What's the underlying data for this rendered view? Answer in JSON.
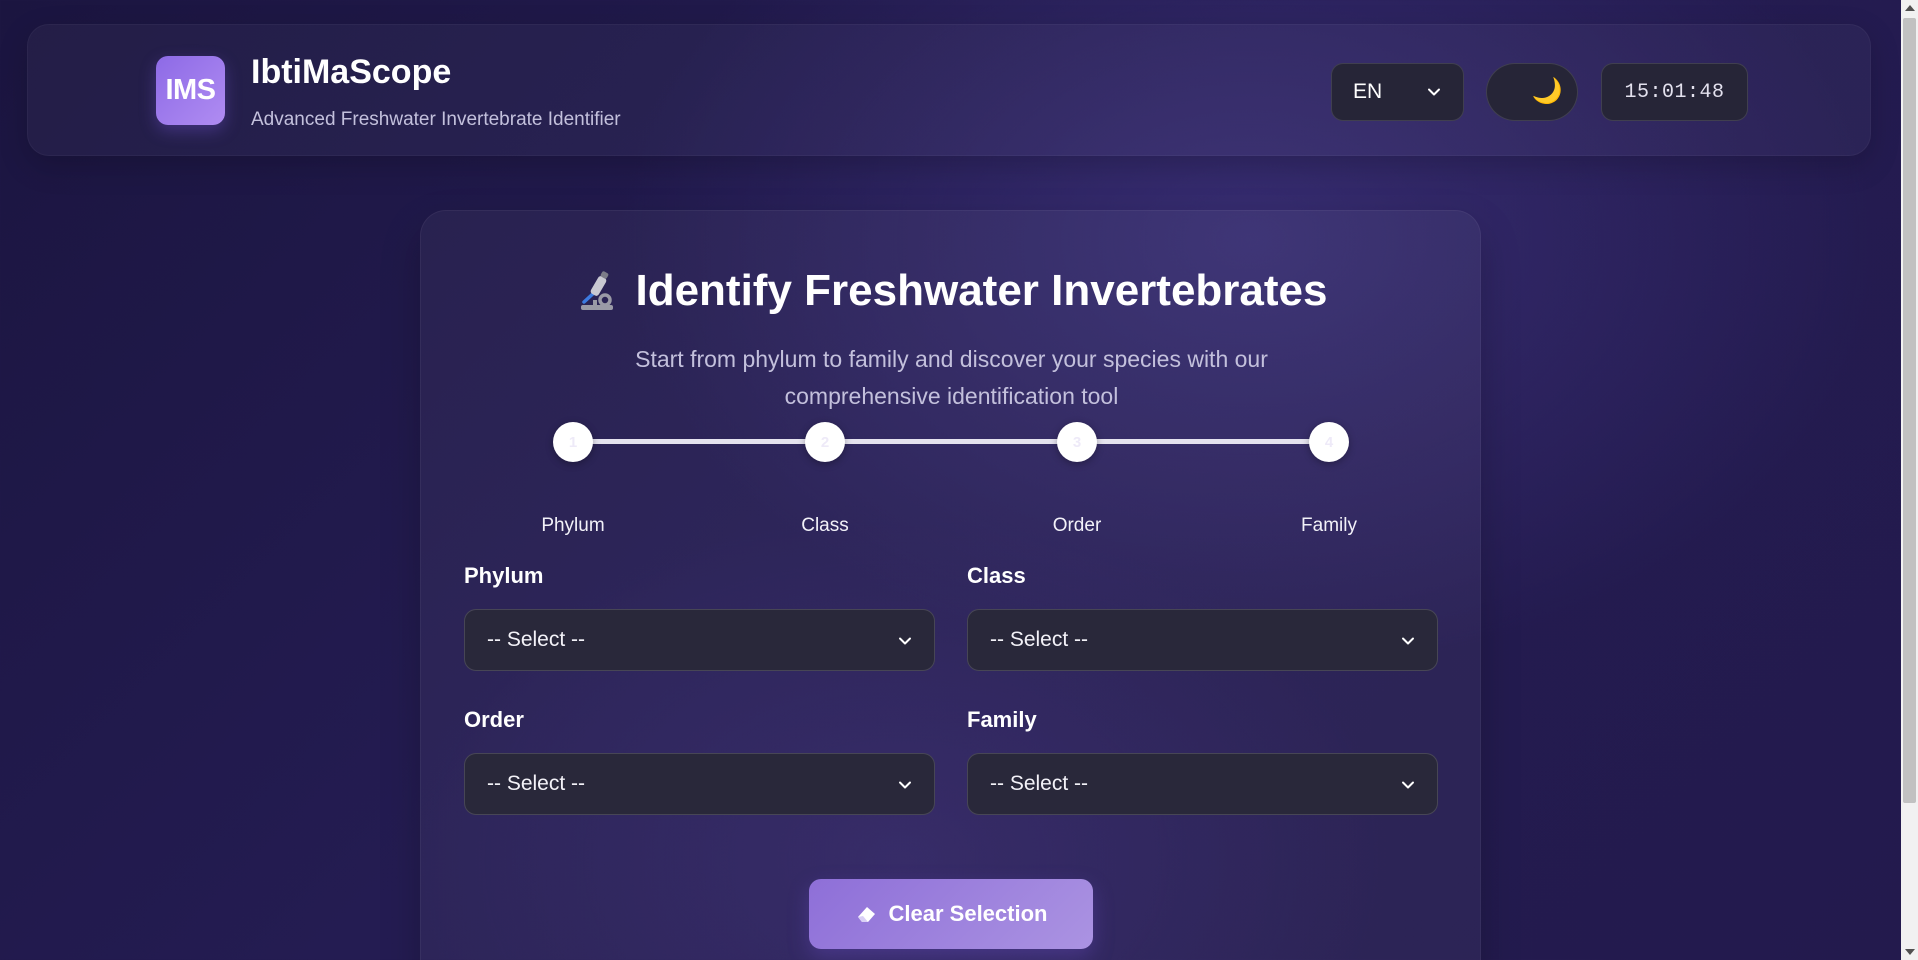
{
  "header": {
    "logo_text": "IMS",
    "title": "IbtiMaScope",
    "subtitle": "Advanced Freshwater Invertebrate Identifier",
    "language": "EN",
    "theme_icon": "moon-icon",
    "clock": "15:01:48"
  },
  "main": {
    "title": "Identify Freshwater Invertebrates",
    "title_icon": "microscope-icon",
    "subtitle": "Start from phylum to family and discover your species with our comprehensive identification tool",
    "steps": [
      {
        "number": "1",
        "label": "Phylum"
      },
      {
        "number": "2",
        "label": "Class"
      },
      {
        "number": "3",
        "label": "Order"
      },
      {
        "number": "4",
        "label": "Family"
      }
    ],
    "fields": {
      "phylum": {
        "label": "Phylum",
        "value": "-- Select --"
      },
      "class": {
        "label": "Class",
        "value": "-- Select --"
      },
      "order": {
        "label": "Order",
        "value": "-- Select --"
      },
      "family": {
        "label": "Family",
        "value": "-- Select --"
      }
    },
    "clear_button": "Clear Selection",
    "clear_icon": "eraser-icon"
  },
  "colors": {
    "accent": "#9a7fe0",
    "background": "#221a4c",
    "panel": "#29283a"
  }
}
